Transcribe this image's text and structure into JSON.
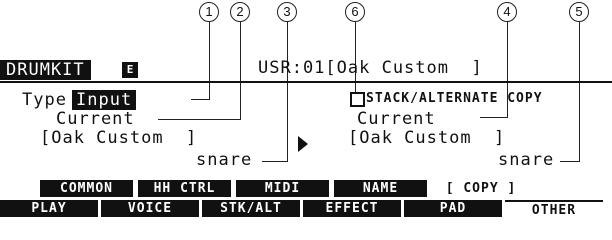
{
  "callouts": [
    "1",
    "2",
    "3",
    "6",
    "4",
    "5"
  ],
  "header": {
    "kit_label": "DRUMKIT",
    "edit_badge": "E",
    "kit_name": "USR:01[Oak Custom  ]"
  },
  "params": {
    "type_label": "Type",
    "type_value": "Input",
    "stack_label": "STACK/ALTERNATE COPY",
    "source_current": "Current",
    "source_kit": "[Oak Custom  ]",
    "source_pad": "snare",
    "dest_current": "Current",
    "dest_kit": "[Oak Custom  ]",
    "dest_pad": "snare"
  },
  "upper_tabs": [
    "COMMON",
    "HH CTRL",
    "MIDI",
    "NAME",
    "[ COPY ]"
  ],
  "lower_tabs": [
    "PLAY",
    "VOICE",
    "STK/ALT",
    "EFFECT",
    "PAD",
    "OTHER"
  ]
}
